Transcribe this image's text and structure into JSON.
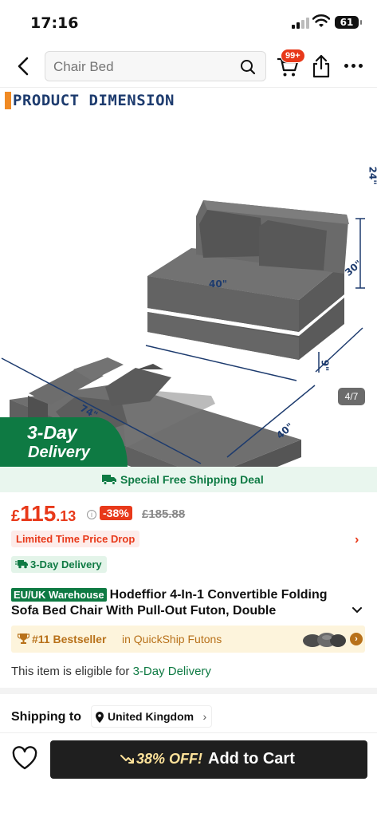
{
  "status": {
    "time": "17:16",
    "battery": "61"
  },
  "navbar": {
    "search_placeholder": "Chair Bed",
    "cart_badge": "99+"
  },
  "hero": {
    "dimension_title": "PRODUCT DIMENSION",
    "dims": {
      "height": "24\"",
      "depth": "30\"",
      "width": "40\"",
      "width2": "40\"",
      "thickness": "9\"",
      "length": "74\""
    },
    "page_indicator": "4/7",
    "delivery_tag_line1": "3-Day",
    "delivery_tag_line2": "Delivery"
  },
  "deal": {
    "label": "Special Free Shipping Deal"
  },
  "price": {
    "currency": "£",
    "whole": "115",
    "decimal": ".13",
    "discount": "-38%",
    "original": "£185.88"
  },
  "badges": {
    "limited": "Limited Time Price Drop",
    "three_day": "3-Day Delivery"
  },
  "product": {
    "warehouse_badge": "EU/UK Warehouse",
    "title": "Hodeffior 4-In-1 Convertible Folding Sofa Bed Chair With Pull-Out Futon, Double"
  },
  "bestseller": {
    "rank": "#11 Bestseller",
    "category": "in QuickShip Futons"
  },
  "eligibility": {
    "prefix": "This item is eligible for",
    "highlight": "3-Day Delivery"
  },
  "shipping": {
    "label": "Shipping to",
    "location": "United Kingdom"
  },
  "bottom": {
    "off_label": "38% OFF!",
    "add_to_cart": "Add to Cart"
  },
  "colors": {
    "accent": "#e8391a",
    "green": "#0e7a43",
    "gold": "#b8711a"
  }
}
